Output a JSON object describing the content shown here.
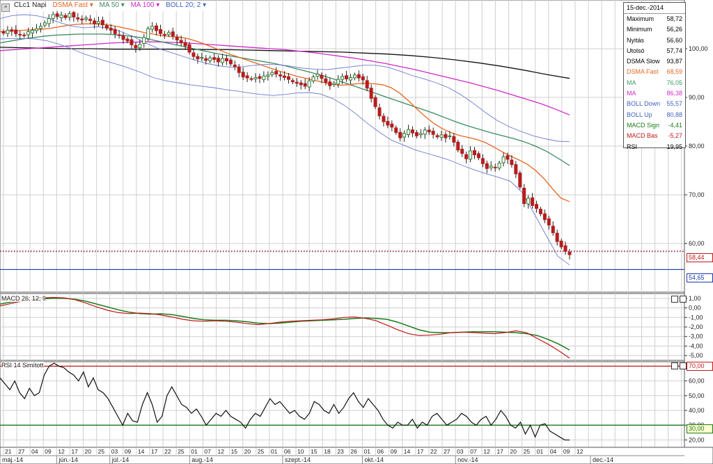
{
  "toolbar": {
    "symbol": "CLc1 Napi",
    "items": [
      "DSMA Fast ▾",
      "MA 50 ▾",
      "MA 100 ▾",
      "BOLL 20; 2 ▾"
    ]
  },
  "info": {
    "date": "15-dec.-2014",
    "rows": [
      {
        "label": "Maximum",
        "value": "58,72",
        "color": "#000000"
      },
      {
        "label": "Minimum",
        "value": "56,26",
        "color": "#000000"
      },
      {
        "label": "Nyitás",
        "value": "56,60",
        "color": "#000000"
      },
      {
        "label": "Utolsó",
        "value": "57,74",
        "color": "#000000"
      },
      {
        "label": "DSMA Slow",
        "value": "93,87",
        "color": "#000000"
      },
      {
        "label": "DSMA Fast",
        "value": "68,59",
        "color": "#e8641e"
      },
      {
        "label": "MA",
        "value": "76,05",
        "color": "#3a9a6a"
      },
      {
        "label": "MA",
        "value": "86,38",
        "color": "#d028c8"
      },
      {
        "label": "BOLL Down",
        "value": "55,57",
        "color": "#4060c0"
      },
      {
        "label": "BOLL Up",
        "value": "80,88",
        "color": "#4060c0"
      },
      {
        "label": "MACD Sign",
        "value": "-4,41",
        "color": "#1a7a1a"
      },
      {
        "label": "MACD Bas",
        "value": "-5,27",
        "color": "#c01818"
      },
      {
        "label": "RSI",
        "value": "19,95",
        "color": "#000000"
      }
    ]
  },
  "price_tags": {
    "upper": "58,44",
    "lower": "54,65"
  },
  "rsi_tags": {
    "upper": "70,00",
    "lower": "30,00"
  },
  "panels": {
    "macd_label": "MACD 26; 12; 9",
    "rsi_label": "RSI 14 Simított"
  },
  "colors": {
    "up": "#2e7d32",
    "down": "#b71c1c",
    "grid": "#cfcfcf",
    "dsma_slow": "#111111",
    "dsma_fast": "#e8641e",
    "ma50": "#3a8a60",
    "ma100": "#d028c8",
    "boll": "#6a7ad0",
    "macd_sig": "#1a7a1a",
    "macd_base": "#c01818",
    "rsi": "#111111"
  },
  "chart_data": [
    {
      "type": "candlestick",
      "title": "CLc1 Napi",
      "ylim": [
        50,
        110
      ],
      "yticks": [
        "60,00",
        "70,00",
        "80,00",
        "90,00",
        "100,00"
      ],
      "ytick_values": [
        60,
        70,
        80,
        90,
        100
      ],
      "day_labels": [
        "21",
        "27",
        "04",
        "09",
        "12",
        "17",
        "20",
        "25",
        "03",
        "09",
        "14",
        "17",
        "22",
        "25",
        "01",
        "07",
        "12",
        "15",
        "20",
        "25",
        "01",
        "06",
        "10",
        "15",
        "18",
        "23",
        "26",
        "01",
        "06",
        "09",
        "14",
        "17",
        "22",
        "27",
        "03",
        "07",
        "12",
        "17",
        "20",
        "25",
        "01",
        "04",
        "09",
        "12"
      ],
      "month_labels": [
        "máj.-14",
        "jún.-14",
        "júl.-14",
        "aug.-14",
        "szept.-14",
        "okt.-14",
        "nov.-14",
        "dec.-14"
      ],
      "close": [
        103.2,
        103.8,
        103.6,
        103.1,
        102.8,
        102.7,
        103.5,
        103.8,
        104.1,
        104.6,
        105.3,
        106.2,
        107.0,
        106.6,
        106.9,
        106.4,
        107.2,
        106.5,
        106.1,
        105.9,
        106.3,
        105.8,
        105.1,
        105.6,
        104.9,
        104.2,
        103.8,
        103.1,
        102.7,
        101.9,
        101.6,
        100.8,
        100.2,
        100.9,
        102.3,
        104.1,
        104.6,
        103.7,
        103.1,
        102.9,
        103.3,
        102.6,
        101.8,
        101.2,
        100.6,
        99.3,
        98.4,
        97.9,
        98.2,
        97.6,
        98.1,
        97.8,
        97.3,
        98.0,
        97.5,
        96.9,
        96.3,
        95.1,
        94.2,
        94.0,
        93.8,
        94.1,
        93.9,
        94.4,
        94.6,
        95.1,
        94.8,
        94.4,
        94.1,
        93.7,
        93.2,
        92.9,
        92.6,
        92.3,
        93.4,
        94.2,
        94.8,
        93.9,
        93.1,
        92.4,
        92.9,
        93.7,
        94.3,
        93.8,
        94.1,
        94.6,
        94.0,
        93.6,
        91.9,
        89.8,
        88.1,
        86.2,
        85.0,
        84.3,
        83.9,
        82.8,
        81.7,
        82.6,
        83.4,
        82.7,
        82.1,
        82.6,
        83.3,
        82.9,
        82.4,
        81.9,
        82.3,
        81.7,
        82.1,
        80.8,
        79.2,
        78.5,
        77.4,
        79.0,
        78.2,
        77.6,
        76.4,
        75.4,
        75.9,
        75.6,
        76.5,
        77.8,
        77.3,
        76.2,
        74.3,
        71.6,
        68.2,
        69.3,
        67.8,
        67.2,
        66.1,
        64.9,
        63.8,
        62.2,
        60.4,
        59.3,
        58.4,
        57.7
      ],
      "dsma_fast": [
        103.5,
        103.6,
        103.7,
        103.8,
        103.9,
        104.0,
        104.2,
        104.5,
        104.8,
        105.0,
        105.1,
        105.1,
        105.0,
        104.8,
        104.5,
        104.1,
        103.7,
        103.3,
        103.0,
        102.7,
        102.5,
        102.4,
        102.1,
        101.6,
        101.0,
        100.3,
        99.6,
        98.9,
        98.3,
        97.7,
        97.1,
        96.5,
        95.9,
        95.3,
        94.8,
        94.3,
        93.9,
        93.5,
        93.1,
        92.7,
        92.5,
        92.6,
        92.8,
        92.9,
        92.8,
        92.6,
        92.0,
        90.9,
        89.4,
        87.7,
        86.1,
        84.7,
        83.6,
        82.8,
        82.2,
        81.8,
        81.4,
        80.8,
        79.9,
        78.9,
        78.0,
        77.2,
        76.3,
        75.0,
        73.3,
        71.2,
        69.3,
        68.6
      ],
      "ma50": [
        101.2,
        101.6,
        102.0,
        102.3,
        102.6,
        102.8,
        102.9,
        103.0,
        103.0,
        103.0,
        102.9,
        102.7,
        102.4,
        102.0,
        101.5,
        101.0,
        100.5,
        100.0,
        99.5,
        99.0,
        98.6,
        98.2,
        97.8,
        97.4,
        97.0,
        96.5,
        95.9,
        95.3,
        94.7,
        94.0,
        93.2,
        92.4,
        91.6,
        90.8,
        90.0,
        89.2,
        88.4,
        87.6,
        86.8,
        85.9,
        85.0,
        84.2,
        83.5,
        82.8,
        82.2,
        81.6,
        80.9,
        80.0,
        78.9,
        77.5,
        76.0
      ],
      "ma100": [
        99.6,
        99.8,
        100.0,
        100.2,
        100.4,
        100.6,
        100.8,
        101.0,
        101.2,
        101.3,
        101.4,
        101.4,
        101.3,
        101.2,
        101.0,
        100.8,
        100.6,
        100.4,
        100.2,
        100.0,
        99.8,
        99.5,
        99.2,
        98.8,
        98.4,
        98.0,
        97.5,
        97.0,
        96.4,
        95.8,
        95.1,
        94.4,
        93.7,
        93.0,
        92.2,
        91.4,
        90.5,
        89.6,
        88.7,
        87.6,
        86.4
      ],
      "dsma_slow": [
        100.3,
        100.2,
        100.1,
        100.0,
        100.0,
        99.9,
        99.9,
        99.9,
        99.9,
        99.8,
        99.8,
        99.7,
        99.6,
        99.5,
        99.4,
        99.3,
        99.1,
        98.9,
        98.6,
        98.2,
        97.7,
        97.1,
        96.4,
        95.6,
        94.7,
        93.9
      ],
      "boll_up": [
        106.2,
        106.8,
        107.0,
        106.8,
        106.2,
        105.3,
        104.6,
        104.3,
        104.5,
        104.3,
        103.5,
        102.5,
        101.2,
        100.1,
        99.3,
        98.5,
        97.7,
        97.0,
        96.5,
        96.2,
        96.3,
        96.6,
        96.8,
        96.7,
        96.4,
        96.0,
        95.8,
        95.7,
        96.0,
        96.3,
        96.6,
        96.6,
        96.2,
        95.4,
        94.5,
        93.8,
        93.0,
        92.0,
        90.6,
        88.9,
        87.0,
        85.3,
        84.0,
        83.0,
        82.1,
        81.5,
        81.0,
        80.9
      ],
      "boll_down": [
        102.0,
        102.1,
        102.1,
        102.0,
        101.6,
        100.9,
        100.0,
        99.0,
        98.2,
        97.4,
        96.7,
        95.9,
        95.0,
        94.0,
        93.4,
        93.0,
        92.6,
        92.3,
        92.0,
        91.6,
        91.3,
        90.9,
        90.6,
        90.4,
        90.6,
        90.9,
        91.0,
        90.7,
        89.8,
        88.4,
        86.6,
        84.6,
        82.8,
        81.2,
        80.2,
        79.2,
        78.5,
        77.8,
        77.0,
        76.0,
        75.1,
        74.3,
        73.6,
        72.8,
        70.5,
        66.2,
        61.8,
        57.4,
        55.6
      ],
      "hlines": [
        58.44,
        54.65
      ]
    },
    {
      "type": "line",
      "title": "MACD 26; 12; 9",
      "ylim": [
        -5.5,
        1.5
      ],
      "yticks": [
        "1,00",
        "0,00",
        "-1,00",
        "-2,00",
        "-3,00",
        "-4,00",
        "-5,00"
      ],
      "ytick_values": [
        1,
        0,
        -1,
        -2,
        -3,
        -4,
        -5
      ],
      "series": [
        {
          "name": "MACD Sign",
          "values": [
            0.4,
            0.6,
            0.75,
            0.85,
            0.95,
            1.0,
            1.0,
            0.9,
            0.7,
            0.4,
            0.1,
            -0.2,
            -0.45,
            -0.6,
            -0.65,
            -0.62,
            -0.7,
            -0.9,
            -1.1,
            -1.25,
            -1.3,
            -1.3,
            -1.35,
            -1.45,
            -1.6,
            -1.65,
            -1.6,
            -1.5,
            -1.4,
            -1.35,
            -1.3,
            -1.25,
            -1.2,
            -1.1,
            -1.05,
            -1.1,
            -1.2,
            -1.5,
            -1.9,
            -2.3,
            -2.55,
            -2.6,
            -2.6,
            -2.55,
            -2.5,
            -2.5,
            -2.5,
            -2.55,
            -2.6,
            -2.7,
            -2.9,
            -3.3,
            -3.8,
            -4.41
          ]
        },
        {
          "name": "MACD Bas",
          "values": [
            0.2,
            0.45,
            0.7,
            0.9,
            1.05,
            1.1,
            1.05,
            0.85,
            0.5,
            0.1,
            -0.25,
            -0.5,
            -0.6,
            -0.55,
            -0.6,
            -0.75,
            -0.95,
            -1.2,
            -1.35,
            -1.4,
            -1.35,
            -1.4,
            -1.5,
            -1.65,
            -1.75,
            -1.65,
            -1.5,
            -1.4,
            -1.35,
            -1.3,
            -1.25,
            -1.15,
            -1.0,
            -0.95,
            -1.1,
            -1.35,
            -1.8,
            -2.3,
            -2.7,
            -2.9,
            -2.85,
            -2.75,
            -2.6,
            -2.55,
            -2.6,
            -2.65,
            -2.7,
            -2.6,
            -2.4,
            -2.6,
            -3.2,
            -3.8,
            -4.5,
            -5.27
          ]
        }
      ]
    },
    {
      "type": "line",
      "title": "RSI 14 Simított",
      "ylim": [
        15,
        73
      ],
      "yticks": [
        "70,00",
        "60,00",
        "50,00",
        "40,00",
        "30,00",
        "20,00"
      ],
      "ytick_values": [
        70,
        60,
        50,
        40,
        30,
        20
      ],
      "series": [
        {
          "name": "RSI",
          "values": [
            62,
            58,
            54,
            60,
            52,
            48,
            55,
            50,
            52,
            64,
            70,
            72,
            70,
            69,
            66,
            64,
            60,
            66,
            56,
            62,
            54,
            52,
            48,
            42,
            36,
            30,
            38,
            33,
            32,
            44,
            52,
            44,
            32,
            36,
            50,
            56,
            50,
            44,
            42,
            38,
            41,
            36,
            30,
            34,
            38,
            36,
            40,
            36,
            34,
            32,
            28,
            34,
            38,
            36,
            42,
            48,
            44,
            46,
            42,
            38,
            40,
            36,
            34,
            38,
            46,
            44,
            40,
            38,
            44,
            38,
            42,
            48,
            52,
            46,
            42,
            48,
            44,
            40,
            34,
            30,
            28,
            32,
            30,
            30,
            34,
            28,
            32,
            30,
            36,
            38,
            34,
            30,
            32,
            34,
            38,
            36,
            32,
            30,
            34,
            36,
            30,
            34,
            40,
            36,
            30,
            28,
            32,
            24,
            30,
            22,
            30,
            31,
            26,
            24,
            22,
            20,
            19.95
          ]
        }
      ]
    }
  ]
}
